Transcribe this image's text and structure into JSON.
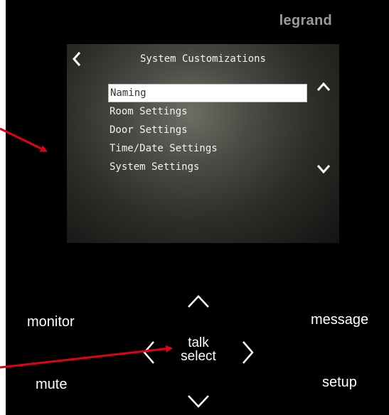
{
  "brand": "legrand",
  "screen": {
    "title": "System Customizations",
    "menu": [
      {
        "label": "Naming",
        "selected": true
      },
      {
        "label": "Room Settings",
        "selected": false
      },
      {
        "label": "Door Settings",
        "selected": false
      },
      {
        "label": "Time/Date Settings",
        "selected": false
      },
      {
        "label": "System Settings",
        "selected": false
      }
    ]
  },
  "keypad": {
    "monitor": "monitor",
    "message": "message",
    "mute": "mute",
    "setup": "setup",
    "center_line1": "talk",
    "center_line2": "select"
  },
  "colors": {
    "annotation_arrow": "#e0001a",
    "brand": "#9a9a9a"
  }
}
